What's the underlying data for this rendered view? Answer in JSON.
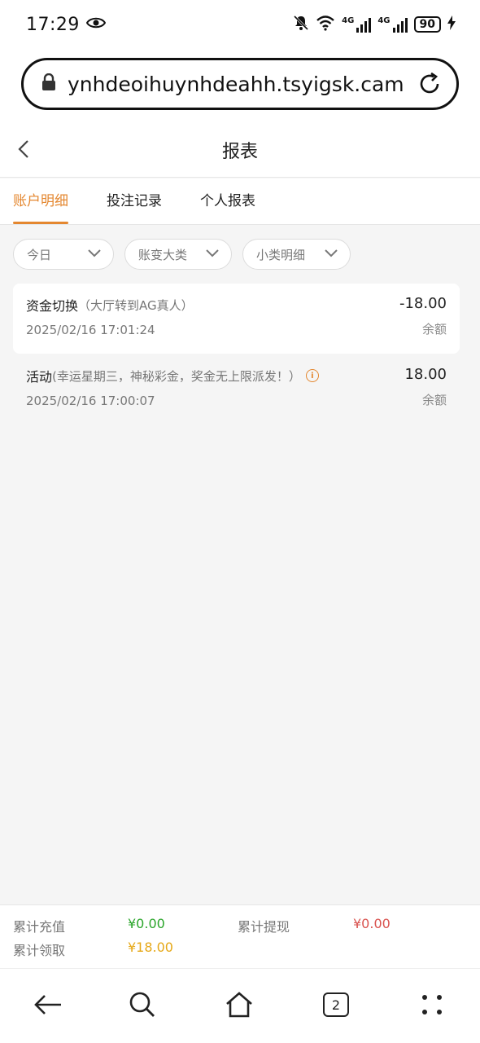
{
  "status_bar": {
    "time": "17:29",
    "network_1": "4G",
    "network_2": "4G",
    "battery": "90"
  },
  "browser": {
    "url": "ynhdeoihuynhdeahh.tsyigsk.cam",
    "open_tabs": "2"
  },
  "header": {
    "title": "报表"
  },
  "tabs": [
    {
      "label": "账户明细",
      "active": true
    },
    {
      "label": "投注记录",
      "active": false
    },
    {
      "label": "个人报表",
      "active": false
    }
  ],
  "filters": [
    {
      "label": "今日"
    },
    {
      "label": "账变大类"
    },
    {
      "label": "小类明细"
    }
  ],
  "records": [
    {
      "title": "资金切换",
      "subtitle": "（大厅转到AG真人）",
      "datetime": "2025/02/16 17:01:24",
      "amount": "-18.00",
      "balance_label": "余额"
    },
    {
      "title": "活动",
      "subtitle": "(幸运星期三，神秘彩金，奖金无上限派发！）",
      "datetime": "2025/02/16 17:00:07",
      "amount": "18.00",
      "balance_label": "余额"
    }
  ],
  "summary": {
    "recharge_label": "累计充值",
    "recharge_value": "¥0.00",
    "withdraw_label": "累计提现",
    "withdraw_value": "¥0.00",
    "claimed_label": "累计领取",
    "claimed_value": "¥18.00"
  },
  "colors": {
    "accent": "#e4872f",
    "positive": "#2aa52a",
    "negative": "#d9534f",
    "gold": "#e6a817"
  }
}
